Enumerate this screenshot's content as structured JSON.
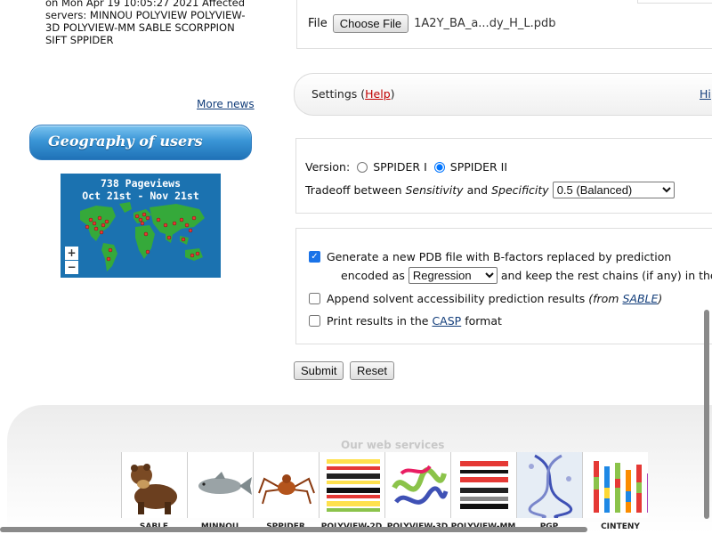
{
  "news": {
    "text": "on Mon Apr 19 10:05:27 2021 Affected servers: MINNOU POLYVIEW POLYVIEW-3D POLYVIEW-MM SABLE SCORPPION SIFT SPPIDER",
    "more_news": "More news"
  },
  "geography": {
    "title": "Geography of users",
    "pageviews": "738 Pageviews",
    "period": "Oct 21st - Nov 21st",
    "zoom_in": "+",
    "zoom_out": "−"
  },
  "form": {
    "file_label": "File",
    "choose_file": "Choose File",
    "file_name": "1A2Y_BA_a...dy_H_L.pdb",
    "settings_label": "Settings (",
    "help": "Help",
    "settings_close": ")",
    "hide": "Hi",
    "version_label": "Version:",
    "version_options": [
      "SPPIDER I",
      "SPPIDER II"
    ],
    "version_selected": "SPPIDER II",
    "tradeoff_prefix": "Tradeoff between ",
    "tradeoff_sensitivity": "Sensitivity",
    "tradeoff_and": " and ",
    "tradeoff_specificity": "Specificity",
    "tradeoff_value": "0.5 (Balanced)",
    "opt1": "Generate a new PDB file with B-factors replaced by prediction",
    "opt1_encoded": "encoded as",
    "opt1_encoding": "Regression",
    "opt1_rest": "and keep the rest chains (if any) in the fil",
    "opt2": "Append solvent accessibility prediction results ",
    "opt2_from": "(from ",
    "opt2_link": "SABLE",
    "opt2_close": ")",
    "opt3_prefix": "Print results in the ",
    "opt3_link": "CASP",
    "opt3_suffix": " format",
    "submit": "Submit",
    "reset": "Reset"
  },
  "services": {
    "title": "Our web services",
    "items": [
      "SABLE",
      "MINNOU",
      "SPPIDER",
      "POLYVIEW-2D",
      "POLYVIEW-3D",
      "POLYVIEW-MM",
      "PGP",
      "CINTENY"
    ]
  },
  "colors": {
    "link": "#123d7a",
    "help": "#c00000",
    "map_bg": "#1b72b0",
    "checkbox": "#1a73e8"
  }
}
